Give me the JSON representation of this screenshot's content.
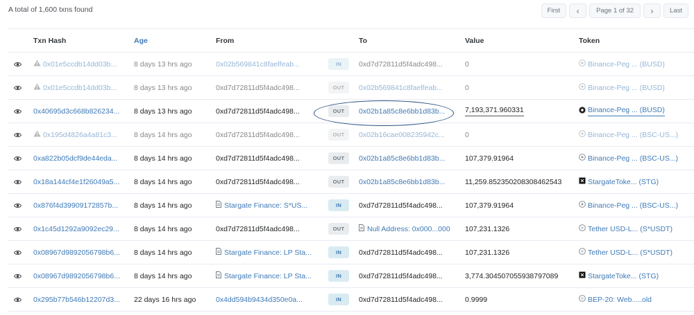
{
  "summary": "A total of 1,600 txns found",
  "pagination": {
    "first": "First",
    "prev": "‹",
    "info": "Page 1 of 32",
    "next": "›",
    "last": "Last"
  },
  "headers": {
    "txn_hash": "Txn Hash",
    "age": "Age",
    "from": "From",
    "to": "To",
    "value": "Value",
    "token": "Token"
  },
  "rows": [
    {
      "hash": "0x01e5ccdb14dd03b...",
      "warn": true,
      "age": "8 days 13 hrs ago",
      "from": "0x02b569841c8faelfeab...",
      "from_link": true,
      "from_doc": false,
      "direction": "IN",
      "to": "0xd7d72811d5f4adc498...",
      "to_link": false,
      "to_doc": false,
      "value": "0",
      "token": "Binance-Peg ... (BUSD)",
      "token_icon": "bnb",
      "dim": true,
      "shade": false,
      "highlight": false
    },
    {
      "hash": "0x01e5ccdb14dd03b...",
      "warn": true,
      "age": "8 days 13 hrs ago",
      "from": "0xd7d72811d5f4adc498...",
      "from_link": false,
      "from_doc": false,
      "direction": "OUT",
      "to": "0x02b569841c8faelfeab...",
      "to_link": true,
      "to_doc": false,
      "value": "0",
      "token": "Binance-Peg ... (BUSD)",
      "token_icon": "bnb",
      "dim": true,
      "shade": false,
      "highlight": false
    },
    {
      "hash": "0x40695d3c668b826234...",
      "warn": false,
      "age": "8 days 13 hrs ago",
      "from": "0xd7d72811d5f4adc498...",
      "from_link": false,
      "from_doc": false,
      "direction": "OUT",
      "to": "0x02b1a85c8e6bb1d83b...",
      "to_link": true,
      "to_doc": false,
      "value": "7,193,371.960331",
      "token": "Binance-Peg ... (BUSD)",
      "token_icon": "bnb-dark",
      "dim": false,
      "shade": false,
      "highlight": true
    },
    {
      "hash": "0x195d4826a4a81c3...",
      "warn": true,
      "age": "8 days 14 hrs ago",
      "from": "0xd7d72811d5f4adc498...",
      "from_link": false,
      "from_doc": false,
      "direction": "OUT",
      "to": "0x02b16cae008235942c...",
      "to_link": true,
      "to_doc": false,
      "value": "0",
      "token": "Binance-Peg ... (BSC-US...)",
      "token_icon": "bnb",
      "dim": true,
      "shade": false,
      "highlight": false
    },
    {
      "hash": "0xa822b05dcf9de44eda...",
      "warn": false,
      "age": "8 days 14 hrs ago",
      "from": "0xd7d72811d5f4adc498...",
      "from_link": false,
      "from_doc": false,
      "direction": "OUT",
      "to": "0x02b1a85c8e6bb1d83b...",
      "to_link": true,
      "to_doc": false,
      "value": "107,379.91964",
      "token": "Binance-Peg ... (BSC-US...)",
      "token_icon": "bnb",
      "dim": false,
      "shade": false,
      "highlight": false
    },
    {
      "hash": "0x18a144cf4e1f26049a5...",
      "warn": false,
      "age": "8 days 14 hrs ago",
      "from": "0xd7d72811d5f4adc498...",
      "from_link": false,
      "from_doc": false,
      "direction": "OUT",
      "to": "0x02b1a85c8e6bb1d83b...",
      "to_link": true,
      "to_doc": false,
      "value": "11,259.852350208308462543",
      "token": "StargateToke... (STG)",
      "token_icon": "stg",
      "dim": false,
      "shade": false,
      "highlight": false
    },
    {
      "hash": "0x876f4d39909172857b...",
      "warn": false,
      "age": "8 days 14 hrs ago",
      "from": "Stargate Finance: S*US...",
      "from_link": true,
      "from_doc": true,
      "direction": "IN",
      "to": "0xd7d72811d5f4adc498...",
      "to_link": false,
      "to_doc": false,
      "value": "107,379.91964",
      "token": "Binance-Peg ... (BSC-US...)",
      "token_icon": "bnb",
      "dim": false,
      "shade": false,
      "highlight": false
    },
    {
      "hash": "0x1c45d1292a9092ec29...",
      "warn": false,
      "age": "8 days 14 hrs ago",
      "from": "0xd7d72811d5f4adc498...",
      "from_link": false,
      "from_doc": false,
      "direction": "OUT",
      "to": "Null Address: 0x000...000",
      "to_link": true,
      "to_doc": true,
      "value": "107,231.1326",
      "token": "Tether USD-L... (S*USDT)",
      "token_icon": "circle",
      "dim": false,
      "shade": false,
      "highlight": false
    },
    {
      "hash": "0x08967d9892056798b6...",
      "warn": false,
      "age": "8 days 14 hrs ago",
      "from": "Stargate Finance: LP Sta...",
      "from_link": true,
      "from_doc": true,
      "direction": "IN",
      "to": "0xd7d72811d5f4adc498...",
      "to_link": false,
      "to_doc": false,
      "value": "107,231.1326",
      "token": "Tether USD-L... (S*USDT)",
      "token_icon": "circle",
      "dim": false,
      "shade": false,
      "highlight": false
    },
    {
      "hash": "0x08967d9892056798b6...",
      "warn": false,
      "age": "8 days 14 hrs ago",
      "from": "Stargate Finance: LP Sta...",
      "from_link": true,
      "from_doc": true,
      "direction": "IN",
      "to": "0xd7d72811d5f4adc498...",
      "to_link": false,
      "to_doc": false,
      "value": "3,774.304507055938797089",
      "token": "StargateToke... (STG)",
      "token_icon": "stg",
      "dim": false,
      "shade": false,
      "highlight": false
    },
    {
      "hash": "0x295b77b546b12207d3...",
      "warn": false,
      "age": "22 days 16 hrs ago",
      "from": "0x4dd594b9434d350e0a...",
      "from_link": true,
      "from_doc": false,
      "direction": "IN",
      "to": "0xd7d72811d5f4adc498...",
      "to_link": false,
      "to_doc": false,
      "value": "0.9999",
      "token": "BEP-20: Web.....old",
      "token_icon": "circle",
      "dim": false,
      "shade": false,
      "highlight": false
    }
  ]
}
